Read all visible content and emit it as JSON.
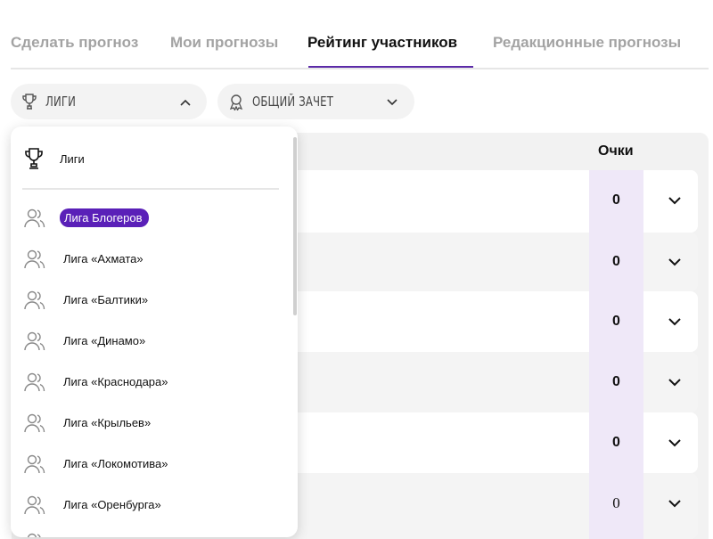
{
  "tabs": [
    {
      "label": "Сделать прогноз",
      "active": false
    },
    {
      "label": "Мои прогнозы",
      "active": false
    },
    {
      "label": "Рейтинг участников",
      "active": true
    },
    {
      "label": "Редакционные прогнозы",
      "active": false
    }
  ],
  "filters": {
    "leagues": {
      "label": "ЛИГИ",
      "icon": "trophy-icon",
      "state": "expanded"
    },
    "standings": {
      "label": "ОБЩИЙ ЗАЧЕТ",
      "icon": "medal-icon",
      "state": "collapsed"
    }
  },
  "table": {
    "points_header": "Очки",
    "rows": [
      {
        "points": "0"
      },
      {
        "points": "0"
      },
      {
        "points": "0"
      },
      {
        "points": "0"
      },
      {
        "points": "0"
      },
      {
        "points": "0"
      }
    ]
  },
  "dropdown": {
    "header": "Лиги",
    "items": [
      {
        "label": "Лига Блогеров",
        "selected": true
      },
      {
        "label": "Лига «Ахмата»",
        "selected": false
      },
      {
        "label": "Лига «Балтики»",
        "selected": false
      },
      {
        "label": "Лига «Динамо»",
        "selected": false
      },
      {
        "label": "Лига «Краснодара»",
        "selected": false
      },
      {
        "label": "Лига «Крыльев»",
        "selected": false
      },
      {
        "label": "Лига «Локомотива»",
        "selected": false
      },
      {
        "label": "Лига «Оренбурга»",
        "selected": false
      }
    ]
  },
  "colors": {
    "accent": "#5a20b8",
    "points_column": "#efe8f8"
  }
}
